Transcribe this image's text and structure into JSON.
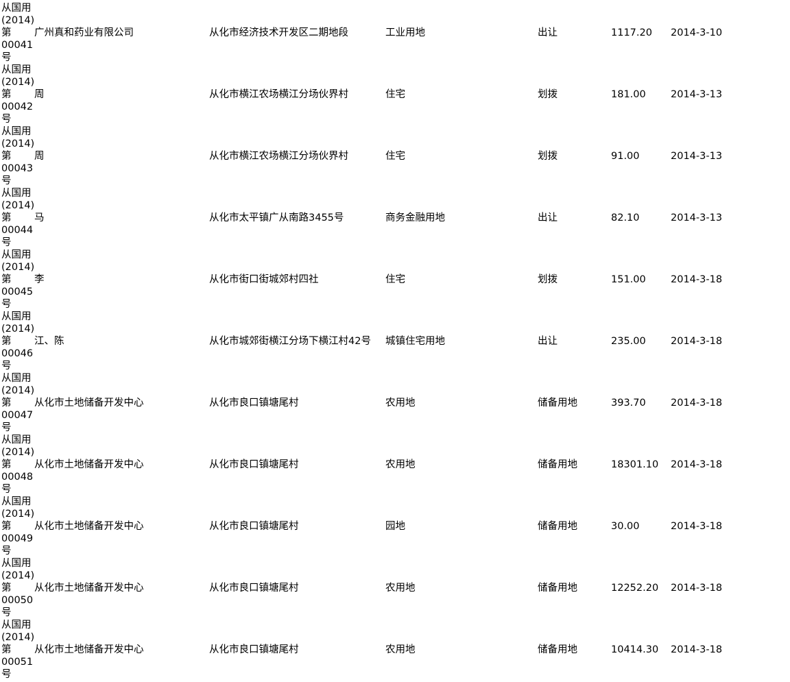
{
  "rows": [
    {
      "cert": [
        "从国用",
        "(2014)",
        "第",
        "00041",
        "号"
      ],
      "holder": "广州真和药业有限公司",
      "location": "从化市经济技术开发区二期地段",
      "use": "工业用地",
      "type": "出让",
      "area": "1117.20",
      "date": "2014-3-10"
    },
    {
      "cert": [
        "从国用",
        "(2014)",
        "第",
        "00042",
        "号"
      ],
      "holder": "周",
      "location": "从化市横江农场横江分场伙界村",
      "use": "住宅",
      "type": "划拨",
      "area": "181.00",
      "date": "2014-3-13"
    },
    {
      "cert": [
        "从国用",
        "(2014)",
        "第",
        "00043",
        "号"
      ],
      "holder": "周",
      "location": "从化市横江农场横江分场伙界村",
      "use": "住宅",
      "type": "划拨",
      "area": "91.00",
      "date": "2014-3-13"
    },
    {
      "cert": [
        "从国用",
        "(2014)",
        "第",
        "00044",
        "号"
      ],
      "holder": "马",
      "location": "从化市太平镇广从南路3455号",
      "use": "商务金融用地",
      "type": "出让",
      "area": "82.10",
      "date": "2014-3-13"
    },
    {
      "cert": [
        "从国用",
        "(2014)",
        "第",
        "00045",
        "号"
      ],
      "holder": "李",
      "location": "从化市街口街城郊村四社",
      "use": "住宅",
      "type": "划拨",
      "area": "151.00",
      "date": "2014-3-18"
    },
    {
      "cert": [
        "从国用",
        "(2014)",
        "第",
        "00046",
        "号"
      ],
      "holder": "江、陈",
      "location": "从化市城郊街横江分场下横江村42号",
      "use": "城镇住宅用地",
      "type": "出让",
      "area": "235.00",
      "date": "2014-3-18"
    },
    {
      "cert": [
        "从国用",
        "(2014)",
        "第",
        "00047",
        "号"
      ],
      "holder": "从化市土地储备开发中心",
      "location": "从化市良口镇塘尾村",
      "use": "农用地",
      "type": "储备用地",
      "area": "393.70",
      "date": "2014-3-18"
    },
    {
      "cert": [
        "从国用",
        "(2014)",
        "第",
        "00048",
        "号"
      ],
      "holder": "从化市土地储备开发中心",
      "location": "从化市良口镇塘尾村",
      "use": "农用地",
      "type": "储备用地",
      "area": "18301.10",
      "date": "2014-3-18"
    },
    {
      "cert": [
        "从国用",
        "(2014)",
        "第",
        "00049",
        "号"
      ],
      "holder": "从化市土地储备开发中心",
      "location": "从化市良口镇塘尾村",
      "use": "园地",
      "type": "储备用地",
      "area": "30.00",
      "date": "2014-3-18"
    },
    {
      "cert": [
        "从国用",
        "(2014)",
        "第",
        "00050",
        "号"
      ],
      "holder": "从化市土地储备开发中心",
      "location": "从化市良口镇塘尾村",
      "use": "农用地",
      "type": "储备用地",
      "area": "12252.20",
      "date": "2014-3-18"
    },
    {
      "cert": [
        "从国用",
        "(2014)",
        "第",
        "00051",
        "号"
      ],
      "holder": "从化市土地储备开发中心",
      "location": "从化市良口镇塘尾村",
      "use": "农用地",
      "type": "储备用地",
      "area": "10414.30",
      "date": "2014-3-18"
    }
  ]
}
